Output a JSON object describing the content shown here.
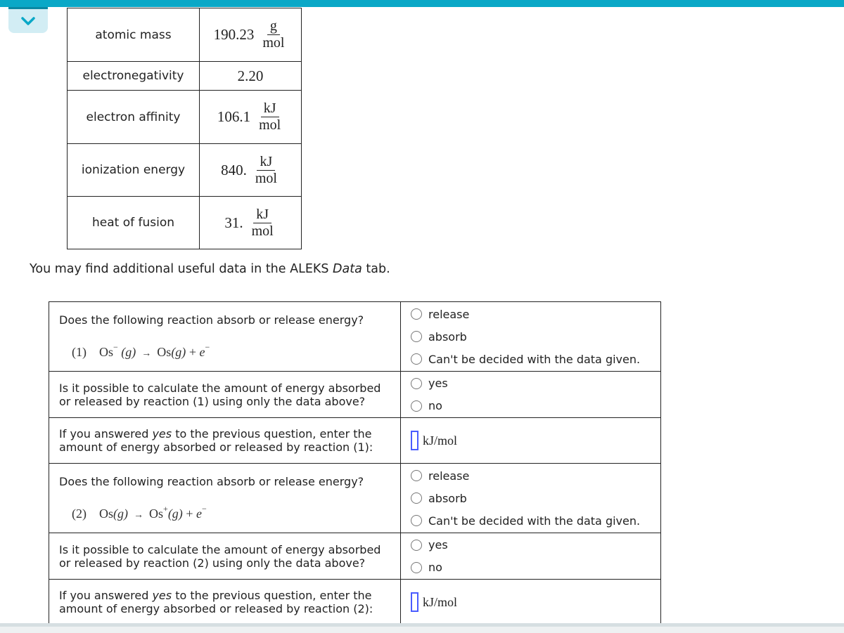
{
  "header": {
    "collapse_icon": "chevron-down-icon",
    "accent_color": "#0aa8c7"
  },
  "properties": [
    {
      "label": "atomic mass",
      "value": "190.23",
      "unit_num": "g",
      "unit_den": "mol"
    },
    {
      "label": "electronegativity",
      "value": "2.20",
      "unit_num": "",
      "unit_den": ""
    },
    {
      "label": "electron affinity",
      "value": "106.1",
      "unit_num": "kJ",
      "unit_den": "mol"
    },
    {
      "label": "ionization energy",
      "value": "840.",
      "unit_num": "kJ",
      "unit_den": "mol"
    },
    {
      "label": "heat of fusion",
      "value": "31.",
      "unit_num": "kJ",
      "unit_den": "mol"
    }
  ],
  "note": {
    "before": "You may find additional useful data in the ALEKS ",
    "italic": "Data",
    "after": " tab."
  },
  "questions": [
    {
      "absorb_release": {
        "prompt": "Does the following reaction absorb or release energy?",
        "equation": {
          "label": "(1)",
          "reactant": "Os",
          "reactant_charge": "−",
          "reactant_state": "(g)",
          "arrow": "→",
          "product": "Os",
          "product_charge": "",
          "product_state": "(g)",
          "plus": "+",
          "electron": "e",
          "electron_charge": "−"
        },
        "options": [
          "release",
          "absorb",
          "Can't be decided with the data given."
        ]
      },
      "possible": {
        "prompt_line1": "Is it possible to calculate the amount of energy absorbed",
        "prompt_line2": "or released by reaction (1) using only the data above?",
        "options": [
          "yes",
          "no"
        ]
      },
      "amount": {
        "prompt_before": "If you answered ",
        "prompt_italic": "yes",
        "prompt_after": " to the previous question, enter the",
        "prompt_line2": "amount of energy absorbed or released by reaction (1):",
        "value": "",
        "unit": "kJ/mol"
      }
    },
    {
      "absorb_release": {
        "prompt": "Does the following reaction absorb or release energy?",
        "equation": {
          "label": "(2)",
          "reactant": "Os",
          "reactant_charge": "",
          "reactant_state": "(g)",
          "arrow": "→",
          "product": "Os",
          "product_charge": "+",
          "product_state": "(g)",
          "plus": "+",
          "electron": "e",
          "electron_charge": "−"
        },
        "options": [
          "release",
          "absorb",
          "Can't be decided with the data given."
        ]
      },
      "possible": {
        "prompt_line1": "Is it possible to calculate the amount of energy absorbed",
        "prompt_line2": "or released by reaction (2) using only the data above?",
        "options": [
          "yes",
          "no"
        ]
      },
      "amount": {
        "prompt_before": "If you answered ",
        "prompt_italic": "yes",
        "prompt_after": " to the previous question, enter the",
        "prompt_line2": "amount of energy absorbed or released by reaction (2):",
        "value": "",
        "unit": "kJ/mol"
      }
    }
  ]
}
